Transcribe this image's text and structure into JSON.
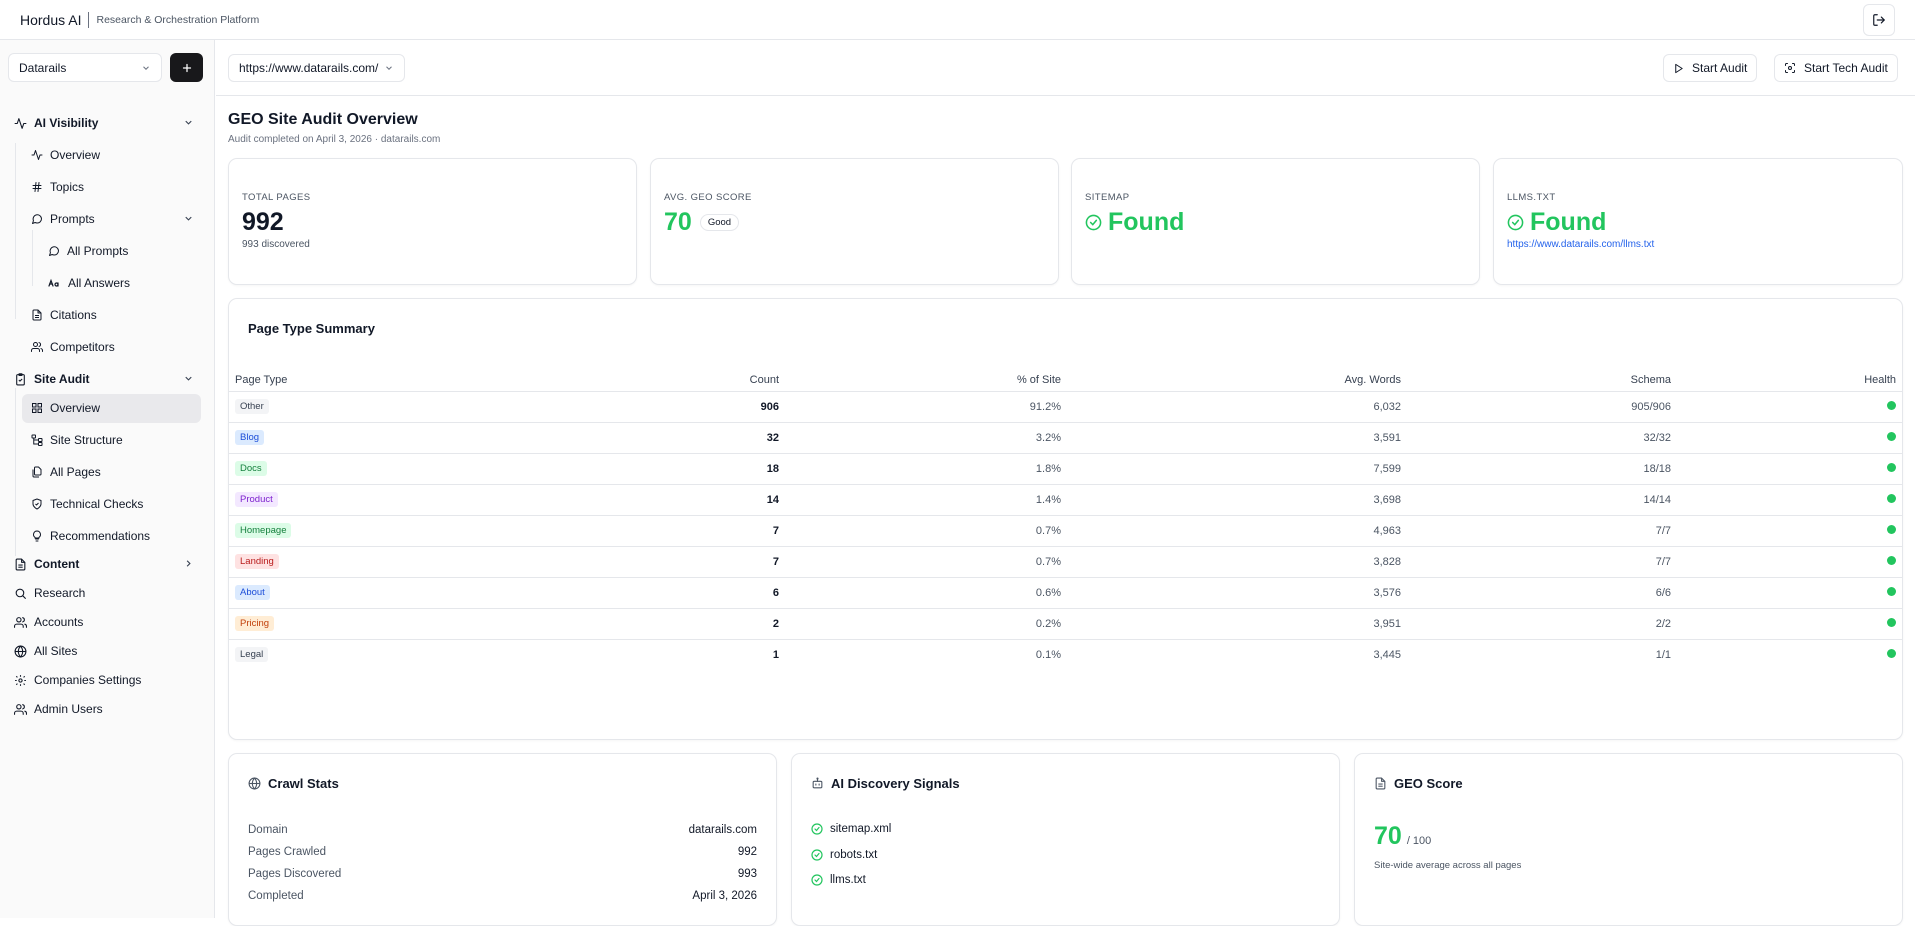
{
  "brand": {
    "name": "Hordus AI",
    "subtitle": "Research & Orchestration Platform"
  },
  "workspace": {
    "selected": "Datarails"
  },
  "nav": {
    "ai_visibility": "AI Visibility",
    "overview": "Overview",
    "topics": "Topics",
    "prompts": "Prompts",
    "all_prompts": "All Prompts",
    "all_answers": "All Answers",
    "citations": "Citations",
    "competitors": "Competitors",
    "site_audit": "Site Audit",
    "sa_overview": "Overview",
    "site_structure": "Site Structure",
    "all_pages": "All Pages",
    "technical_checks": "Technical Checks",
    "recommendations": "Recommendations",
    "content": "Content",
    "research": "Research",
    "accounts": "Accounts",
    "all_sites": "All Sites",
    "companies_settings": "Companies Settings",
    "admin_users": "Admin Users"
  },
  "toolbar": {
    "url": "https://www.datarails.com/",
    "start_audit": "Start Audit",
    "start_tech_audit": "Start Tech Audit"
  },
  "header": {
    "title": "GEO Site Audit Overview",
    "subtitle": "Audit completed on April 3, 2026  · datarails.com"
  },
  "kpis": {
    "total_pages": {
      "label": "TOTAL PAGES",
      "value": "992",
      "sub": "993 discovered"
    },
    "avg_geo": {
      "label": "AVG. GEO SCORE",
      "value": "70",
      "badge": "Good"
    },
    "sitemap": {
      "label": "SITEMAP",
      "value": "Found"
    },
    "llms": {
      "label": "LLMS.TXT",
      "value": "Found",
      "link": "https://www.datarails.com/llms.txt"
    }
  },
  "page_type_summary": {
    "title": "Page Type Summary",
    "columns": [
      "Page Type",
      "Count",
      "% of Site",
      "Avg. Words",
      "Schema",
      "Health"
    ],
    "rows": [
      {
        "type": "Other",
        "count": "906",
        "pct": "91.2%",
        "words": "6,032",
        "schema": "905/906",
        "tag_bg": "#f3f4f6",
        "tag_fg": "#374151"
      },
      {
        "type": "Blog",
        "count": "32",
        "pct": "3.2%",
        "words": "3,591",
        "schema": "32/32",
        "tag_bg": "#dbeafe",
        "tag_fg": "#1d4ed8"
      },
      {
        "type": "Docs",
        "count": "18",
        "pct": "1.8%",
        "words": "7,599",
        "schema": "18/18",
        "tag_bg": "#dcfce7",
        "tag_fg": "#15803d"
      },
      {
        "type": "Product",
        "count": "14",
        "pct": "1.4%",
        "words": "3,698",
        "schema": "14/14",
        "tag_bg": "#f3e8ff",
        "tag_fg": "#7e22ce"
      },
      {
        "type": "Homepage",
        "count": "7",
        "pct": "0.7%",
        "words": "4,963",
        "schema": "7/7",
        "tag_bg": "#dcfce7",
        "tag_fg": "#15803d"
      },
      {
        "type": "Landing",
        "count": "7",
        "pct": "0.7%",
        "words": "3,828",
        "schema": "7/7",
        "tag_bg": "#fee2e2",
        "tag_fg": "#b91c1c"
      },
      {
        "type": "About",
        "count": "6",
        "pct": "0.6%",
        "words": "3,576",
        "schema": "6/6",
        "tag_bg": "#dbeafe",
        "tag_fg": "#1d4ed8"
      },
      {
        "type": "Pricing",
        "count": "2",
        "pct": "0.2%",
        "words": "3,951",
        "schema": "2/2",
        "tag_bg": "#ffedd5",
        "tag_fg": "#c2410c"
      },
      {
        "type": "Legal",
        "count": "1",
        "pct": "0.1%",
        "words": "3,445",
        "schema": "1/1",
        "tag_bg": "#f3f4f6",
        "tag_fg": "#374151"
      }
    ]
  },
  "crawl_stats": {
    "title": "Crawl Stats",
    "rows": [
      {
        "k": "Domain",
        "v": "datarails.com"
      },
      {
        "k": "Pages Crawled",
        "v": "992"
      },
      {
        "k": "Pages Discovered",
        "v": "993"
      },
      {
        "k": "Completed",
        "v": "April 3, 2026"
      }
    ]
  },
  "ai_signals": {
    "title": "AI Discovery Signals",
    "items": [
      "sitemap.xml",
      "robots.txt",
      "llms.txt"
    ]
  },
  "geo_score": {
    "title": "GEO Score",
    "value": "70",
    "out_of": "/ 100",
    "caption": "Site-wide average across all pages"
  },
  "colors": {
    "green": "#22c55e",
    "link": "#2563eb",
    "active_bg": "#e9e9ec"
  }
}
